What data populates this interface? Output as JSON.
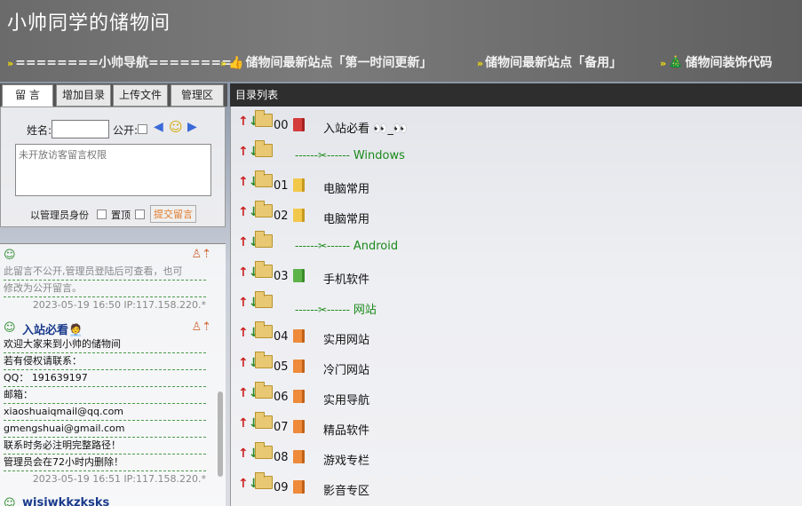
{
  "header": {
    "title": "小帅同学的储物间",
    "nav": [
      {
        "arrow": "»",
        "icon": "",
        "label": "========小帅导航========"
      },
      {
        "arrow": "»",
        "icon": "👍",
        "label": "储物间最新站点「第一时间更新」"
      },
      {
        "arrow": "»",
        "icon": "",
        "label": "储物间最新站点「备用」"
      },
      {
        "arrow": "»",
        "icon": "🎄",
        "label": "储物间装饰代码"
      }
    ]
  },
  "left": {
    "tabs": [
      "留 言",
      "增加目录",
      "上传文件",
      "管理区"
    ],
    "form": {
      "name_label": "姓名:",
      "public_label": "公开:",
      "arrow_left": "◀",
      "smiley": "☺",
      "arrow_right": "▶",
      "message_placeholder": "未开放访客留言权限",
      "admin_label": "以管理员身份",
      "pin_label": "置顶",
      "submit_label": "提交留言"
    },
    "messages": [
      {
        "title": "",
        "lines": [
          "此留言不公开,管理员登陆后可查看，也可",
          "修改为公开留言。"
        ],
        "meta": "2023-05-19 16:50 IP:117.158.220.*"
      },
      {
        "title": "入站必看🧑‍💼",
        "lines": [
          "欢迎大家来到小帅的储物间",
          "若有侵权请联系：",
          "QQ：  191639197",
          "邮箱：",
          "xiaoshuaiqmail@qq.com",
          "gmengshuai@gmail.com",
          "联系时务必注明完整路径！",
          "管理员会在72小时内删除！"
        ],
        "meta": "2023-05-19 16:51 IP:117.158.220.*"
      },
      {
        "title": "wisjwkkzksks",
        "lines": [],
        "meta": ""
      }
    ]
  },
  "right": {
    "header": "目录列表",
    "rows": [
      {
        "type": "dir",
        "num": "00",
        "book": "red",
        "name": "入站必看 👀_👀"
      },
      {
        "type": "sep",
        "name": "Windows"
      },
      {
        "type": "dir",
        "num": "01",
        "book": "yellow",
        "name": "电脑常用"
      },
      {
        "type": "dir",
        "num": "02",
        "book": "yellow",
        "name": "电脑常用"
      },
      {
        "type": "sep",
        "name": "Android"
      },
      {
        "type": "dir",
        "num": "03",
        "book": "green",
        "name": "手机软件"
      },
      {
        "type": "sep",
        "name": "网站"
      },
      {
        "type": "dir",
        "num": "04",
        "book": "orange",
        "name": "实用网站"
      },
      {
        "type": "dir",
        "num": "05",
        "book": "orange",
        "name": "冷门网站"
      },
      {
        "type": "dir",
        "num": "06",
        "book": "orange",
        "name": "实用导航"
      },
      {
        "type": "dir",
        "num": "07",
        "book": "orange",
        "name": "精品软件"
      },
      {
        "type": "dir",
        "num": "08",
        "book": "orange",
        "name": "游戏专栏"
      },
      {
        "type": "dir",
        "num": "09",
        "book": "orange",
        "name": "影音专区"
      }
    ]
  }
}
